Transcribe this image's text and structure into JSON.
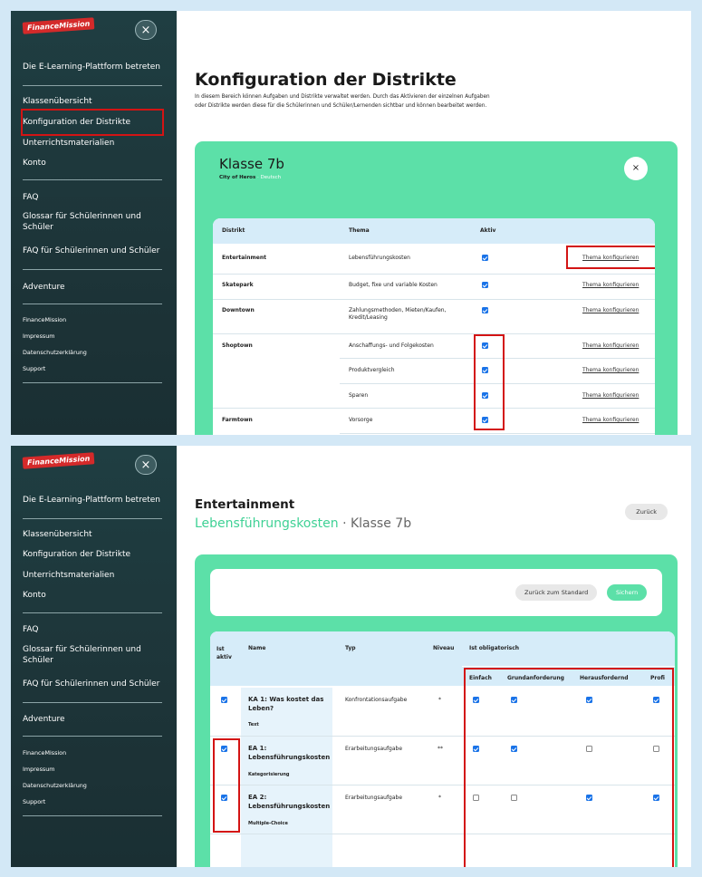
{
  "logo": "FinanceMission",
  "sidebar": {
    "close": "×",
    "enter": "Die E-Learning-Plattform betreten",
    "items": [
      "Klassenübersicht",
      "Konfiguration der Distrikte",
      "Unterrichtsmaterialien",
      "Konto"
    ],
    "faq": "FAQ",
    "glossar": "Glossar für Schülerinnen und Schüler",
    "faq_students": "FAQ für Schülerinnen und Schüler",
    "adventure": "Adventure",
    "footer": [
      "FinanceMission",
      "Impressum",
      "Datenschutzerklärung",
      "Support"
    ]
  },
  "screen1": {
    "title": "Konfiguration der Distrikte",
    "intro": "In diesem Bereich können Aufgaben und Distrikte verwaltet werden. Durch das Aktivieren der einzelnen Aufgaben oder Distrikte werden diese für die Schülerinnen und Schüler/Lernenden sichtbar und können bearbeitet werden.",
    "class_title": "Klasse 7b",
    "class_world": "City of Heros",
    "class_sep": " · ",
    "class_subject": "Deutsch",
    "close": "×",
    "headers": [
      "Distrikt",
      "Thema",
      "Aktiv"
    ],
    "link_label": "Thema konfigurieren",
    "rows": [
      {
        "district": "Entertainment",
        "topic": "Lebensführungskosten",
        "active": true
      },
      {
        "district": "Skatepark",
        "topic": "Budget, fixe und variable Kosten",
        "active": true
      },
      {
        "district": "Downtown",
        "topic": "Zahlungsmethoden, Mieten/Kaufen, Kredit/Leasing",
        "active": true
      },
      {
        "district": "Shoptown",
        "topic": "Anschaffungs- und Folgekosten",
        "active": true
      },
      {
        "district": "",
        "topic": "Produktvergleich",
        "active": true
      },
      {
        "district": "",
        "topic": "Sparen",
        "active": true
      },
      {
        "district": "Farmtown",
        "topic": "Vorsorge",
        "active": true
      }
    ]
  },
  "screen2": {
    "title": "Entertainment",
    "subtitle_topic": "Lebensführungskosten",
    "subtitle_rest": " · Klasse 7b",
    "back": "Zurück",
    "reset": "Zurück zum Standard",
    "save": "Sichern",
    "headers": {
      "active": "Ist aktiv",
      "name": "Name",
      "type": "Typ",
      "level": "Niveau",
      "mandatory": "Ist obligatorisch"
    },
    "levels": [
      "Einfach",
      "Grundanforderung",
      "Herausfordernd",
      "Profi"
    ],
    "tasks": [
      {
        "active": true,
        "name": "KA 1: Was kostet das Leben?",
        "kind": "Text",
        "type": "Konfrontationsaufgabe",
        "level": "*",
        "req": [
          true,
          true,
          true,
          true
        ]
      },
      {
        "active": true,
        "name": "EA 1: Lebensführungskosten",
        "kind": "Kategorisierung",
        "type": "Erarbeitungsaufgabe",
        "level": "**",
        "req": [
          true,
          true,
          false,
          false
        ]
      },
      {
        "active": true,
        "name": "EA 2: Lebensführungskosten",
        "kind": "Multiple-Choice",
        "type": "Erarbeitungsaufgabe",
        "level": "*",
        "req": [
          false,
          false,
          true,
          true
        ]
      }
    ]
  }
}
